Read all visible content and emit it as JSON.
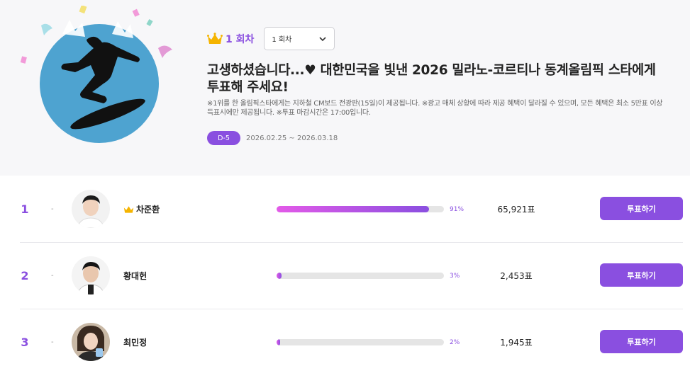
{
  "hero": {
    "round_label": "1 회차",
    "round_select": "1 회차",
    "title": "고생하셨습니다...♥ 대한민국을 빛낸 2026 밀라노-코르티나 동계올림픽 스타에게 투표해 주세요!",
    "notice": "※1위를 한 올림픽스타에게는 지하철 CM보드 전광판(15일)이 제공됩니다. ※광고 매체 상황에 따라 제공 혜택이 달라질 수 있으며, 모든 혜택은 최소 5만표 이상 득표시에만 제공됩니다. ※투표 마감시간은 17:00입니다.",
    "dday": "D-5",
    "period": "2026.02.25 ~ 2026.03.18"
  },
  "colors": {
    "accent": "#8a4fe0",
    "gradient_start": "#e35ae8",
    "hero_bg": "#f7f7f9",
    "circle": "#4ea3d0"
  },
  "icons": {
    "round_crown": "crown-icon",
    "select": "chevron-down-icon",
    "leader_crown": "crown-icon"
  },
  "candidates": [
    {
      "rank": "1",
      "change": "-",
      "name": "차준환",
      "percent_label": "91%",
      "percent": 91,
      "votes": "65,921표",
      "button": "투표하기"
    },
    {
      "rank": "2",
      "change": "-",
      "name": "황대헌",
      "percent_label": "3%",
      "percent": 3,
      "votes": "2,453표",
      "button": "투표하기"
    },
    {
      "rank": "3",
      "change": "-",
      "name": "최민정",
      "percent_label": "2%",
      "percent": 2,
      "votes": "1,945표",
      "button": "투표하기"
    }
  ]
}
